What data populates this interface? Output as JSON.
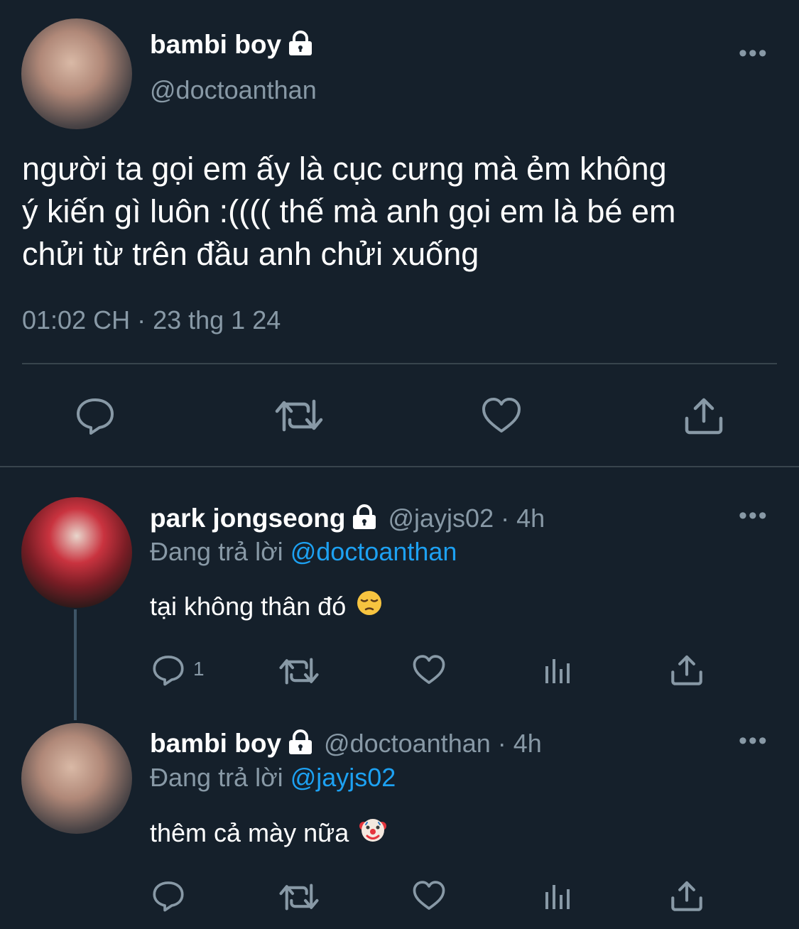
{
  "main_tweet": {
    "display_name": "bambi boy",
    "handle": "@doctoanthan",
    "text_lines": [
      "người ta gọi em ấy là cục cưng mà ẻm không",
      "ý kiến gì luôn :(((( thế mà anh gọi em là bé em",
      "chửi từ trên đầu anh chửi xuống"
    ],
    "timestamp": "01:02 CH · 23 thg 1 24",
    "more": "•••"
  },
  "reply1": {
    "display_name": "park jongseong",
    "handle": "@jayjs02",
    "time": "· 4h",
    "replying_prefix": "Đang trả lời",
    "replying_to": "@doctoanthan",
    "text": "tại không thân đó",
    "reply_count": "1",
    "more": "•••"
  },
  "reply2": {
    "display_name": "bambi boy",
    "handle": "@doctoanthan",
    "time": "· 4h",
    "replying_prefix": "Đang trả lời",
    "replying_to": "@jayjs02",
    "text": "thêm cả mày nữa",
    "more": "•••"
  },
  "icons": [
    "lock-icon",
    "more-icon",
    "reply-icon",
    "retweet-icon",
    "like-icon",
    "share-icon",
    "analytics-icon",
    "pensive-face-emoji",
    "clown-face-emoji"
  ],
  "colors": {
    "background": "#15202b",
    "text": "#ffffff",
    "secondary": "#8899a6",
    "link": "#1da1f2",
    "divider": "#38444d"
  }
}
